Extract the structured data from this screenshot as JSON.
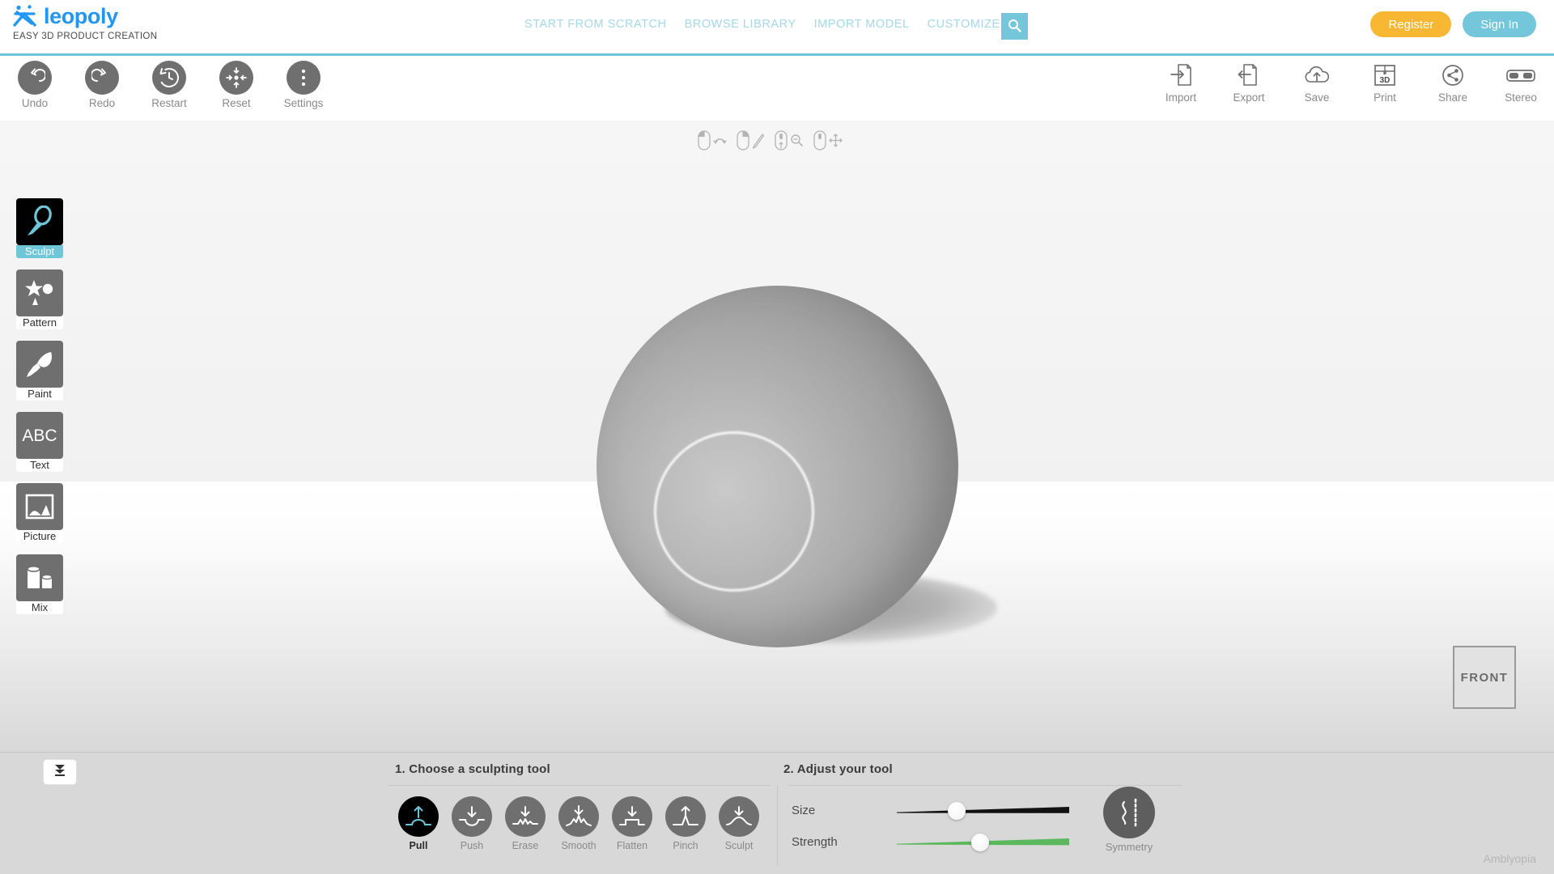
{
  "header": {
    "brand_name": "leopoly",
    "brand_tagline": "EASY 3D PRODUCT CREATION",
    "brand_mark_icon": "leopoly-figure-icon",
    "nav": [
      {
        "label": "START FROM SCRATCH",
        "name": "nav-start-from-scratch"
      },
      {
        "label": "BROWSE LIBRARY",
        "name": "nav-browse-library"
      },
      {
        "label": "IMPORT MODEL",
        "name": "nav-import-model"
      },
      {
        "label": "CUSTOMIZERS",
        "name": "nav-customizers"
      }
    ],
    "search_icon": "search-icon",
    "register_label": "Register",
    "signin_label": "Sign In",
    "accent_teal": "#6ec6d9",
    "register_color": "#f7b733",
    "signin_color": "#74c6db",
    "nav_link_color": "#a5d8e8",
    "brand_color": "#2196f3"
  },
  "toolbar": {
    "left_tools": [
      {
        "label": "Undo",
        "icon": "undo-arrow-icon"
      },
      {
        "label": "Redo",
        "icon": "redo-arrow-icon"
      },
      {
        "label": "Restart",
        "icon": "restart-clock-icon"
      },
      {
        "label": "Reset",
        "icon": "reset-center-icon"
      },
      {
        "label": "Settings",
        "icon": "settings-dots-icon"
      }
    ],
    "right_tools": [
      {
        "label": "Import",
        "icon": "import-file-icon"
      },
      {
        "label": "Export",
        "icon": "export-file-icon"
      },
      {
        "label": "Save",
        "icon": "cloud-upload-icon"
      },
      {
        "label": "Print",
        "icon": "print-3d-icon"
      },
      {
        "label": "Share",
        "icon": "share-nodes-icon"
      },
      {
        "label": "Stereo",
        "icon": "stereo-glasses-icon"
      }
    ],
    "mouse_hints": [
      {
        "mouse": "mouse-left-button-icon",
        "action": "rotate-icon"
      },
      {
        "mouse": "mouse-right-button-icon",
        "action": "pencil-draw-icon"
      },
      {
        "mouse": "mouse-scroll-wheel-icon",
        "action": "zoom-magnifier-icon"
      },
      {
        "mouse": "mouse-middle-button-icon",
        "action": "pan-move-icon"
      }
    ]
  },
  "sidebar": {
    "items": [
      {
        "label": "Sculpt",
        "icon": "sculpt-tool-icon",
        "active": true
      },
      {
        "label": "Pattern",
        "icon": "pattern-shapes-icon",
        "active": false
      },
      {
        "label": "Paint",
        "icon": "paint-brush-icon",
        "active": false
      },
      {
        "label": "Text",
        "icon": "text-abc-icon",
        "active": false
      },
      {
        "label": "Picture",
        "icon": "picture-image-icon",
        "active": false
      },
      {
        "label": "Mix",
        "icon": "mix-cylinders-icon",
        "active": false
      }
    ]
  },
  "viewport": {
    "model": "sphere",
    "viewcube_label": "FRONT",
    "brush_cursor": "brush-ring-cursor",
    "sky_color": "#f1f1f1",
    "ground_top_color": "#ffffff",
    "ground_bottom_color": "#d8d8d8"
  },
  "bottom_panel": {
    "collapse_icon": "collapse-double-chevron-icon",
    "step1_title": "1. Choose a sculpting tool",
    "step2_title": "2. Adjust your tool",
    "sculpt_tools": [
      {
        "label": "Pull",
        "icon": "pull-up-arrow-bump-icon",
        "active": true
      },
      {
        "label": "Push",
        "icon": "push-down-arrow-dip-icon",
        "active": false
      },
      {
        "label": "Erase",
        "icon": "erase-down-arrow-ripple-icon",
        "active": false
      },
      {
        "label": "Smooth",
        "icon": "smooth-down-arrow-peaks-icon",
        "active": false
      },
      {
        "label": "Flatten",
        "icon": "flatten-down-arrow-plateau-icon",
        "active": false
      },
      {
        "label": "Pinch",
        "icon": "pinch-up-arrow-spike-icon",
        "active": false
      },
      {
        "label": "Sculpt",
        "icon": "sculpt-down-arrow-mound-icon",
        "active": false
      }
    ],
    "sliders": [
      {
        "label": "Size",
        "value": 33,
        "color": "#111111"
      },
      {
        "label": "Strength",
        "value": 48,
        "color": "#5cb85c"
      }
    ],
    "symmetry_label": "Symmetry",
    "symmetry_icon": "symmetry-mirror-icon",
    "watermark": "Amblyopia"
  }
}
